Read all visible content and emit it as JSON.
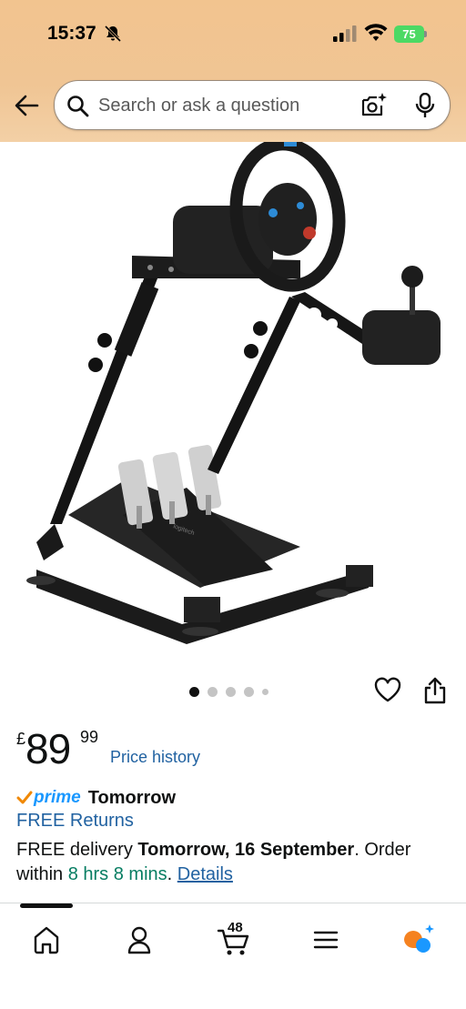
{
  "status_bar": {
    "time": "15:37",
    "battery": "75"
  },
  "search": {
    "placeholder": "Search or ask a question"
  },
  "carousel": {
    "count": 5,
    "active_index": 0
  },
  "product": {
    "currency": "£",
    "price_whole": "89",
    "price_fraction": "99",
    "price_history_label": "Price history",
    "prime_label": "prime",
    "prime_delivery_day": "Tomorrow",
    "free_returns_label": "FREE Returns",
    "delivery": {
      "prefix": "FREE delivery ",
      "date": "Tomorrow, 16 September",
      "middle": ". Order within ",
      "countdown": "8 hrs 8 mins",
      "sep": ". ",
      "details_label": "Details"
    }
  },
  "bottom_nav": {
    "cart_count": "48",
    "items": [
      "home-icon",
      "account-icon",
      "cart-icon",
      "menu-icon",
      "rufus-icon"
    ]
  },
  "colors": {
    "header_bg": "#f2c48f",
    "link": "#2162a1",
    "prime": "#1a98ff",
    "countdown": "#067d62",
    "check": "#f08804"
  }
}
